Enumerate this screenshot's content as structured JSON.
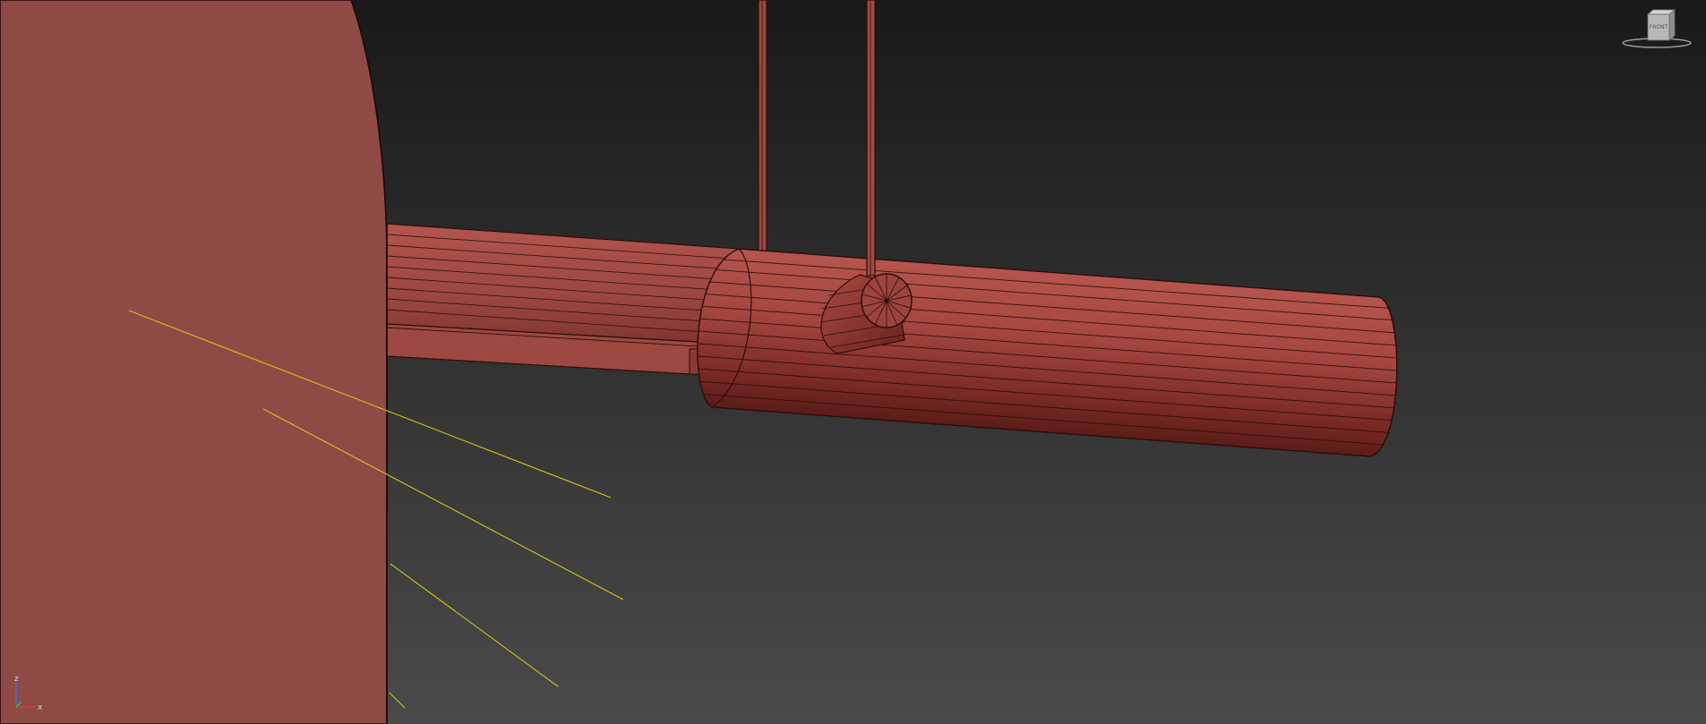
{
  "viewport": {
    "background_top": "#191919",
    "background_bottom": "#4a4a4a"
  },
  "colors": {
    "wall": "#8f4a46",
    "tube_light": "#b4544c",
    "tube_mid": "#8e3a33",
    "tube_dark": "#4a1511",
    "edge": "#2b0d0b",
    "light_rays": "#d8c21c"
  },
  "viewcube": {
    "face_label": "FRONT",
    "icon": "viewcube-icon"
  },
  "axis_tripod": {
    "z_label": "z",
    "x_label": "x",
    "z_color": "#3a6fd8",
    "x_color": "#d83a2e",
    "y_color": "#3ab84a"
  }
}
